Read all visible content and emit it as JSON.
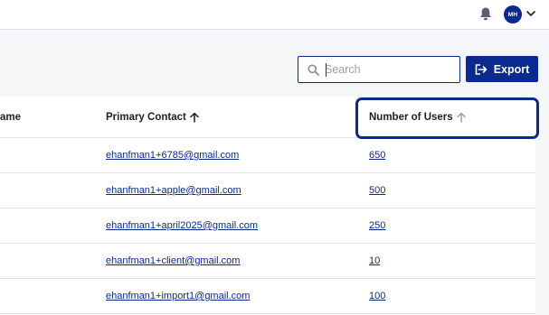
{
  "header": {
    "notifications_icon": "bell-icon",
    "avatar_initials": "MH",
    "menu_icon": "chevron-down-icon"
  },
  "toolbar": {
    "search_placeholder": "Search",
    "export_label": "Export"
  },
  "table": {
    "columns": [
      {
        "label": "ame",
        "sort": "none"
      },
      {
        "label": "Primary Contact",
        "sort": "ascending"
      },
      {
        "label": "Number of Users",
        "sort": "inactive"
      }
    ],
    "rows": [
      {
        "contact": "ehanfman1+6785@gmail.com",
        "users": "650"
      },
      {
        "contact": "ehanfman1+apple@gmail.com",
        "users": "500"
      },
      {
        "contact": "ehanfman1+april2025@gmail.com",
        "users": "250"
      },
      {
        "contact": "ehanfman1+client@gmail.com",
        "users": "10"
      },
      {
        "contact": "ehanfman1+import1@gmail.com",
        "users": "100"
      }
    ]
  },
  "colors": {
    "brand": "#0b2a8f",
    "background": "#f5f6f8",
    "border": "#dfe1e6"
  }
}
